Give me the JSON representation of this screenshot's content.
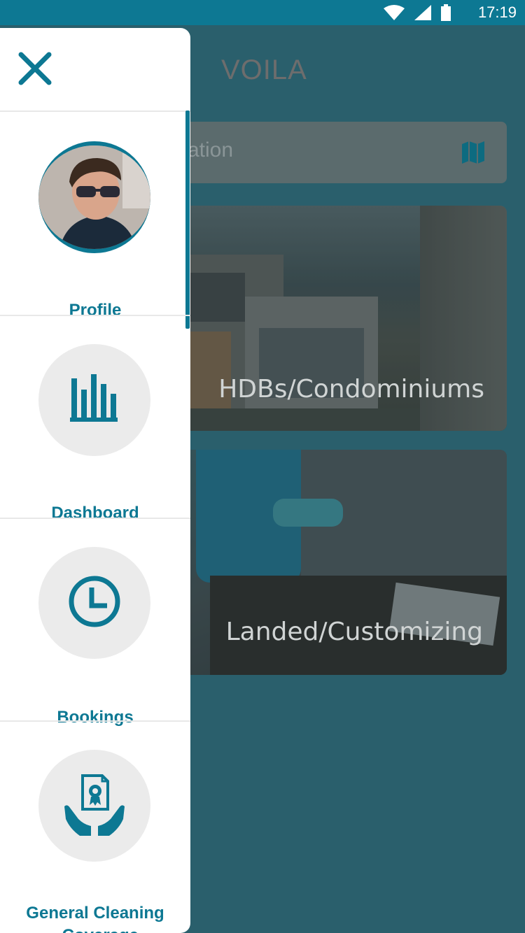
{
  "status_bar": {
    "time": "17:19",
    "icons": [
      "wifi-icon",
      "signal-icon",
      "battery-icon"
    ]
  },
  "app": {
    "title": "VOILA",
    "search": {
      "placeholder": "ation",
      "icon": "map-icon"
    },
    "cards": [
      {
        "label": "HDBs/Condominiums"
      },
      {
        "label": "Landed/Customizing"
      }
    ]
  },
  "drawer": {
    "close_icon": "close-icon",
    "items": [
      {
        "label": "Profile",
        "icon": "avatar"
      },
      {
        "label": "Dashboard",
        "icon": "bar-chart-icon"
      },
      {
        "label": "Bookings",
        "icon": "clock-icon"
      },
      {
        "label_line1": "General Cleaning",
        "label_line2": "- Coverage",
        "icon": "certificate-hands-icon"
      }
    ]
  },
  "colors": {
    "accent": "#0d7893",
    "drawer_bg": "#ffffff",
    "icon_circle": "#ebebeb",
    "app_bg": "#2a5f6c"
  }
}
